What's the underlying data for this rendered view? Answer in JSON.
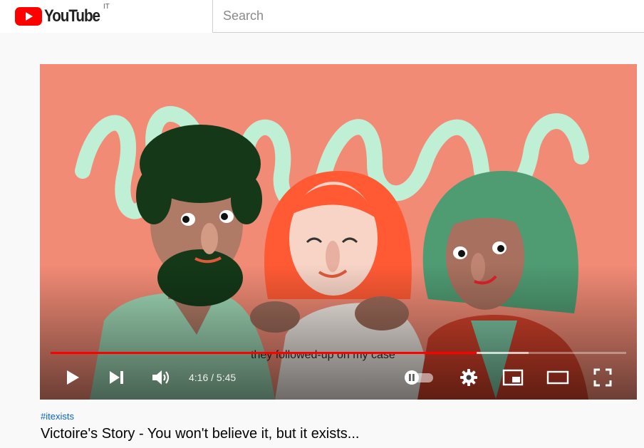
{
  "header": {
    "logo_text": "YouTube",
    "region_code": "IT",
    "search_placeholder": "Search"
  },
  "player": {
    "caption": "they followed-up on my case",
    "time_current": "4:16",
    "time_total": "5:45",
    "time_display": "4:16 / 5:45",
    "progress_fraction": 0.74,
    "buffered_fraction": 0.83,
    "autoplay": "on"
  },
  "video": {
    "hashtag": "#itexists",
    "title": "Victoire's Story - You won't believe it, but it exists..."
  },
  "colors": {
    "brand_red": "#ff0000",
    "hashtag_blue": "#065fd4",
    "video_background": "#f28b76"
  }
}
